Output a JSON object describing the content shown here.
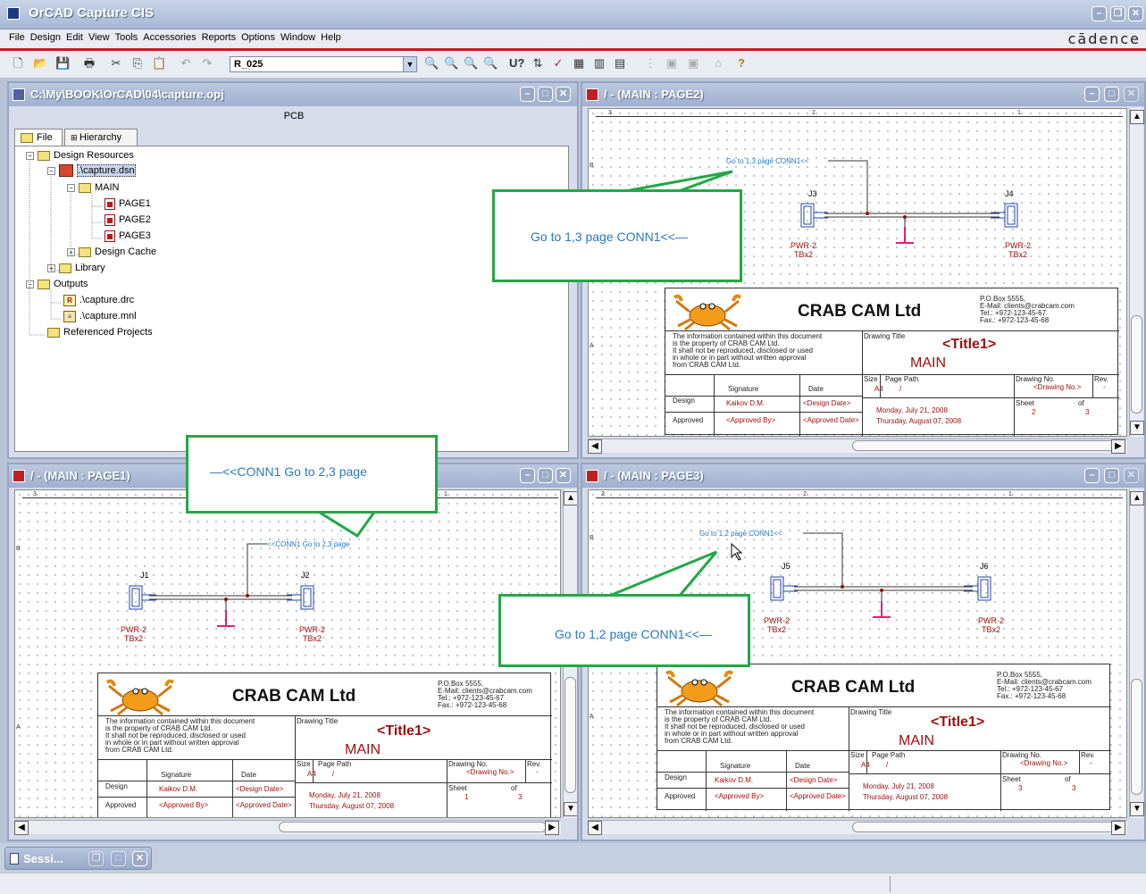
{
  "app": {
    "title": "OrCAD Capture CIS",
    "brand": "cādence"
  },
  "menu": [
    "File",
    "Design",
    "Edit",
    "View",
    "Tools",
    "Accessories",
    "Reports",
    "Options",
    "Window",
    "Help"
  ],
  "toolbar": {
    "part_combo": "R_025"
  },
  "project_window": {
    "title": "C:\\My\\BOOK\\OrCAD\\04\\capture.opj",
    "header": "PCB",
    "tabs": [
      "File",
      "Hierarchy"
    ],
    "tree": {
      "design_resources": "Design Resources",
      "dsn": ".\\capture.dsn",
      "main": "MAIN",
      "page1": "PAGE1",
      "page2": "PAGE2",
      "page3": "PAGE3",
      "design_cache": "Design Cache",
      "library": "Library",
      "outputs": "Outputs",
      "drc": ".\\capture.drc",
      "mnl": ".\\capture.mnl",
      "referenced": "Referenced Projects"
    }
  },
  "page2": {
    "title": "/ - (MAIN : PAGE2)",
    "offpage": "Go to 1,3 page  CONN1<<",
    "callout": "Go to 1,3 page  CONN1<<—",
    "left_ref": "J3",
    "right_ref": "J4",
    "part": "PWR-2",
    "pkg": "TBx2",
    "sheet_no": "2",
    "sheet_of": "3"
  },
  "page1": {
    "title": "/ - (MAIN : PAGE1)",
    "offpage": "<<CONN1  Go to 2,3 page",
    "callout": "—<<CONN1  Go to 2,3 page",
    "left_ref": "J1",
    "right_ref": "J2",
    "part": "PWR-2",
    "pkg": "TBx2",
    "sheet_no": "1",
    "sheet_of": "3"
  },
  "page3": {
    "title": "/ - (MAIN : PAGE3)",
    "offpage": "Go to 1,2 page  CONN1<<",
    "callout": "Go to 1,2 page  CONN1<<—",
    "left_ref": "J5",
    "right_ref": "J6",
    "part": "PWR-2",
    "pkg": "TBx2",
    "sheet_no": "3",
    "sheet_of": "3"
  },
  "title_block": {
    "company": "CRAB CAM Ltd",
    "address": [
      "P.O.Box 5555,",
      "E-Mail: clients@crabcam.com",
      "Tel.: +972-123-45-67",
      "Fax.: +972-123-45-68"
    ],
    "notice": [
      "The information contained within this document",
      "is the property of CRAB CAM Ltd.",
      "It shall not be reproduced, disclosed or used",
      "in whole or in part without written approval",
      "from CRAB CAM Ltd."
    ],
    "drawing_title_lbl": "Drawing Title",
    "title": "<Title1>",
    "main": "MAIN",
    "signature_lbl": "Signature",
    "date_lbl": "Date",
    "design_lbl": "Design",
    "designer": "Kaikov D.M.",
    "design_date": "<Design Date>",
    "approved_lbl": "Approved",
    "approved_by": "<Approved By>",
    "approved_date": "<Approved Date>",
    "size_lbl": "Size",
    "size": "A4",
    "page_path_lbl": "Page Path",
    "page_path": "/",
    "drawing_no_lbl": "Drawing No.",
    "drawing_no": "<Drawing No.>",
    "rev_lbl": "Rev.",
    "rev": "-",
    "date1": "Monday, July 21, 2008",
    "date2": "Thursday, August 07, 2008",
    "sheet_lbl": "Sheet",
    "of_lbl": "of"
  },
  "ruler": {
    "c3": "3",
    "c2": "2",
    "c1": "1",
    "rB": "B",
    "rA": "A"
  },
  "taskbar": {
    "session": "Sessi..."
  },
  "colors": {
    "accent_red": "#a01010",
    "callout_border": "#22a845",
    "offpage_blue": "#2a78c0",
    "gnd_magenta": "#e0207a"
  }
}
